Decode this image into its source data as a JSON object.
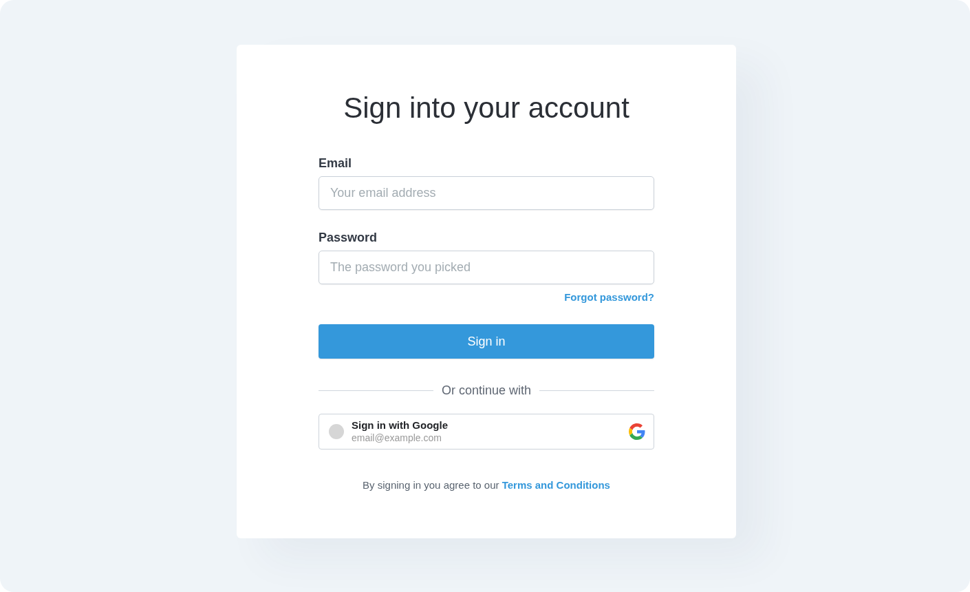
{
  "title": "Sign into your account",
  "fields": [
    {
      "label": "Email",
      "placeholder": "Your email address"
    },
    {
      "label": "Password",
      "placeholder": "The password you picked"
    }
  ],
  "forgot_link": "Forgot password?",
  "submit_button": "Sign in",
  "divider": "Or continue with",
  "google_button": {
    "title": "Sign in with Google",
    "email": "email@example.com"
  },
  "terms": {
    "text": "By signing in you agree to our",
    "link": "Terms and Conditions"
  }
}
